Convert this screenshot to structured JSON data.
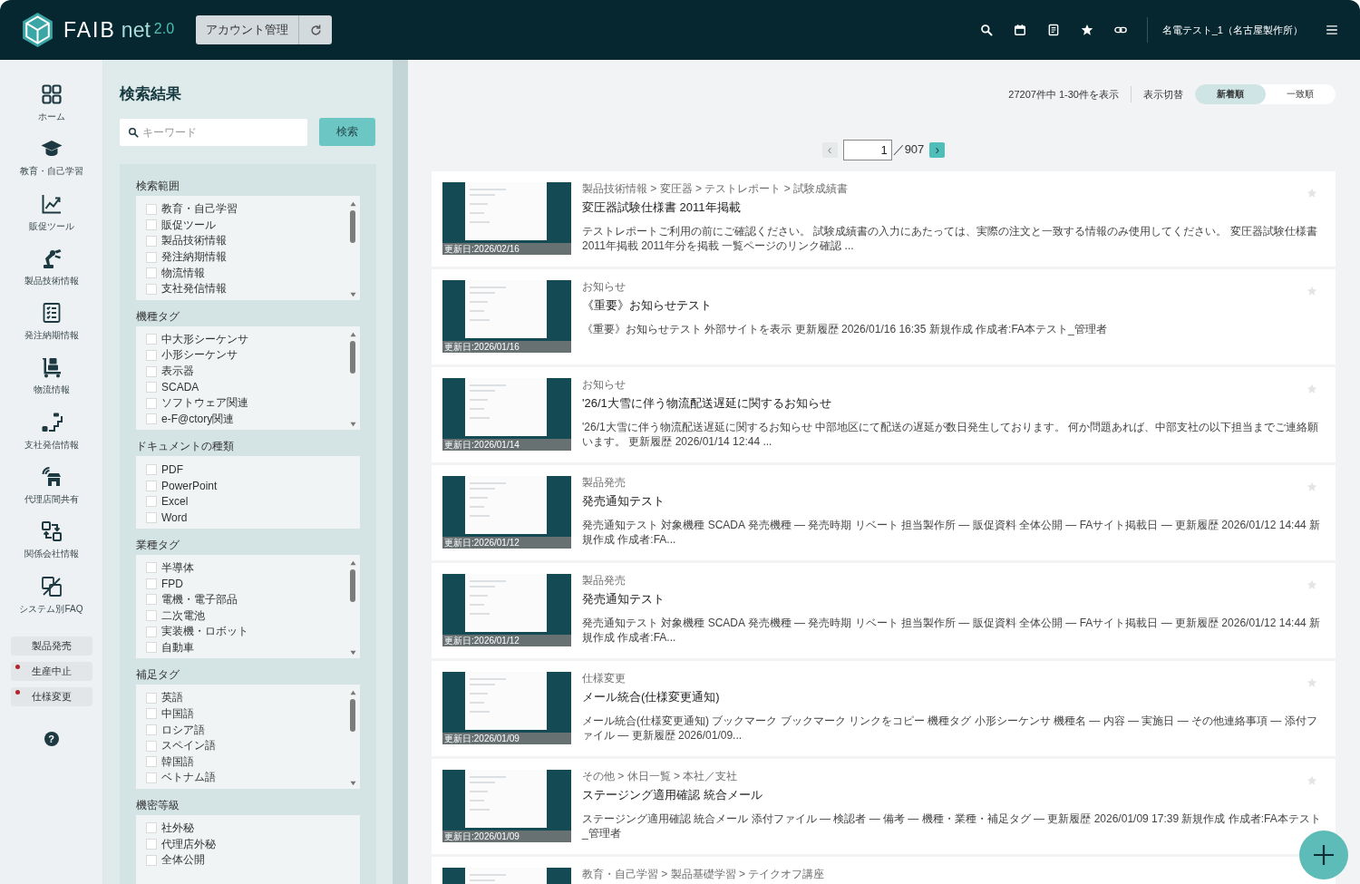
{
  "header": {
    "logo": {
      "brand": "FAIB",
      "product": "net",
      "version": "2.0"
    },
    "account_button": "アカウント管理",
    "user_name": "名電テスト_1（名古屋製作所）"
  },
  "sidebar": {
    "items": [
      {
        "label": "ホーム"
      },
      {
        "label": "教育・自己学習"
      },
      {
        "label": "販促ツール"
      },
      {
        "label": "製品技術情報"
      },
      {
        "label": "発注納期情報"
      },
      {
        "label": "物流情報"
      },
      {
        "label": "支社発信情報"
      },
      {
        "label": "代理店間共有"
      },
      {
        "label": "関係会社情報"
      },
      {
        "label": "システム別FAQ"
      }
    ],
    "tags": [
      {
        "label": "製品発売",
        "unread": false
      },
      {
        "label": "生産中止",
        "unread": true
      },
      {
        "label": "仕様変更",
        "unread": true
      }
    ],
    "help": "?"
  },
  "search_panel": {
    "title": "検索結果",
    "search": {
      "placeholder": "キーワード"
    },
    "search_button": "検索",
    "filters": [
      {
        "title": "検索範囲",
        "scrollable": true,
        "options": [
          {
            "label": "教育・自己学習",
            "checked": false
          },
          {
            "label": "販促ツール",
            "checked": false
          },
          {
            "label": "製品技術情報",
            "checked": false
          },
          {
            "label": "発注納期情報",
            "checked": false
          },
          {
            "label": "物流情報",
            "checked": false
          },
          {
            "label": "支社発信情報",
            "checked": false
          }
        ]
      },
      {
        "title": "機種タグ",
        "scrollable": true,
        "options": [
          {
            "label": "中大形シーケンサ",
            "checked": false
          },
          {
            "label": "小形シーケンサ",
            "checked": false
          },
          {
            "label": "表示器",
            "checked": false
          },
          {
            "label": "SCADA",
            "checked": false
          },
          {
            "label": "ソフトウェア関連",
            "checked": false
          },
          {
            "label": "e-F@ctory関連",
            "checked": false
          }
        ]
      },
      {
        "title": "ドキュメントの種類",
        "scrollable": false,
        "options": [
          {
            "label": "PDF",
            "checked": false
          },
          {
            "label": "PowerPoint",
            "checked": false
          },
          {
            "label": "Excel",
            "checked": false
          },
          {
            "label": "Word",
            "checked": false
          }
        ]
      },
      {
        "title": "業種タグ",
        "scrollable": true,
        "options": [
          {
            "label": "半導体",
            "checked": false
          },
          {
            "label": "FPD",
            "checked": false
          },
          {
            "label": "電機・電子部品",
            "checked": false
          },
          {
            "label": "二次電池",
            "checked": false
          },
          {
            "label": "実装機・ロボット",
            "checked": false
          },
          {
            "label": "自動車",
            "checked": false
          }
        ]
      },
      {
        "title": "補足タグ",
        "scrollable": true,
        "options": [
          {
            "label": "英語",
            "checked": false
          },
          {
            "label": "中国語",
            "checked": false
          },
          {
            "label": "ロシア語",
            "checked": false
          },
          {
            "label": "スペイン語",
            "checked": false
          },
          {
            "label": "韓国語",
            "checked": false
          },
          {
            "label": "ベトナム語",
            "checked": false
          }
        ]
      },
      {
        "title": "機密等級",
        "scrollable": false,
        "options": [
          {
            "label": "社外秘",
            "checked": false
          },
          {
            "label": "代理店外秘",
            "checked": false
          },
          {
            "label": "全体公開",
            "checked": false
          }
        ]
      }
    ]
  },
  "results": {
    "summary": "27207件中 1-30件を表示",
    "view_label": "表示切替",
    "sort": [
      {
        "label": "新着順",
        "selected": true
      },
      {
        "label": "一致順",
        "selected": false
      }
    ],
    "pagination": {
      "prev": {
        "label": "‹",
        "disabled": true
      },
      "page": "1",
      "total": "／907",
      "next": {
        "label": "›",
        "disabled": false
      }
    },
    "items": [
      {
        "breadcrumb": "製品技術情報 > 変圧器 > テストレポート > 試験成績書",
        "title": "変圧器試験仕様書 2011年掲載",
        "description": "テストレポートご利用の前にご確認ください。 試験成績書の入力にあたっては、実際の注文と一致する情報のみ使用してください。 変圧器試験仕様書 2011年掲載 2011年分を掲載 一覧ページのリンク確認 ...",
        "updated": "更新日:2026/02/16",
        "bookmarked": false
      },
      {
        "breadcrumb": "お知らせ",
        "title": "《重要》お知らせテスト",
        "description": "《重要》お知らせテスト 外部サイトを表示 更新履歴 2026/01/16 16:35 新規作成 作成者:FA本テスト_管理者",
        "updated": "更新日:2026/01/16",
        "bookmarked": false
      },
      {
        "breadcrumb": "お知らせ",
        "title": "'26/1大雪に伴う物流配送遅延に関するお知らせ",
        "description": "'26/1大雪に伴う物流配送遅延に関するお知らせ 中部地区にて配送の遅延が数日発生しております。 何か問題あれば、中部支社の以下担当までご連絡願います。 更新履歴 2026/01/14 12:44 ...",
        "updated": "更新日:2026/01/14",
        "bookmarked": false
      },
      {
        "breadcrumb": "製品発売",
        "title": "発売通知テスト",
        "description": "発売通知テスト 対象機種 SCADA 発売機種 — 発売時期 リベート 担当製作所 — 販促資料 全体公開 — FAサイト掲載日 — 更新履歴 2026/01/12 14:44 新規作成 作成者:FA...",
        "updated": "更新日:2026/01/12",
        "bookmarked": false
      },
      {
        "breadcrumb": "製品発売",
        "title": "発売通知テスト",
        "description": "発売通知テスト 対象機種 SCADA 発売機種 — 発売時期 リベート 担当製作所 — 販促資料 全体公開 — FAサイト掲載日 — 更新履歴 2026/01/12 14:44 新規作成 作成者:FA...",
        "updated": "更新日:2026/01/12",
        "bookmarked": false
      },
      {
        "breadcrumb": "仕様変更",
        "title": "メール統合(仕様変更通知)",
        "description": "メール統合(仕様変更通知) ブックマーク ブックマーク リンクをコピー 機種タグ 小形シーケンサ 機種名 — 内容 — 実施日 — その他連絡事項 — 添付ファイル — 更新履歴 2026/01/09...",
        "updated": "更新日:2026/01/09",
        "bookmarked": false
      },
      {
        "breadcrumb": "その他 > 休日一覧 > 本社／支社",
        "title": "ステージング適用確認 統合メール",
        "description": "ステージング適用確認 統合メール 添付ファイル — 検認者 — 備考 — 機種・業種・補足タグ — 更新履歴 2026/01/09 17:39 新規作成 作成者:FA本テスト_管理者",
        "updated": "更新日:2026/01/09",
        "bookmarked": false
      },
      {
        "breadcrumb": "教育・自己学習 > 製品基礎学習 > テイクオフ講座"
      }
    ]
  }
}
